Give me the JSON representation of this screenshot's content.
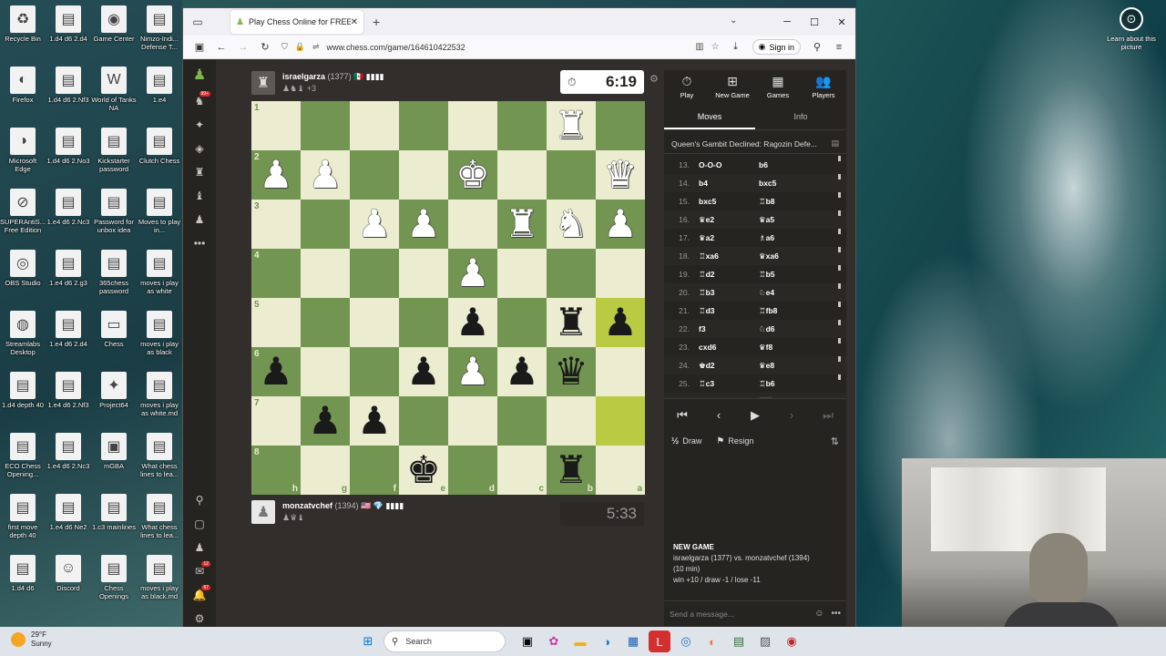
{
  "desktop": {
    "icons": [
      {
        "label": "Recycle Bin",
        "glyph": "♻"
      },
      {
        "label": "1.d4 d6 2.d4",
        "glyph": "▤"
      },
      {
        "label": "Game Center",
        "glyph": "◉"
      },
      {
        "label": "Nimzo-Indi... Defense T...",
        "glyph": "▤"
      },
      {
        "label": "Firefox",
        "glyph": "◐"
      },
      {
        "label": "1.d4 d6 2.Nf3",
        "glyph": "▤"
      },
      {
        "label": "World of Tanks NA",
        "glyph": "W"
      },
      {
        "label": "1.e4",
        "glyph": "▤"
      },
      {
        "label": "Microsoft Edge",
        "glyph": "◑"
      },
      {
        "label": "1.d4 d6 2.No3",
        "glyph": "▤"
      },
      {
        "label": "Kickstarter password",
        "glyph": "▤"
      },
      {
        "label": "Clutch Chess",
        "glyph": "▤"
      },
      {
        "label": "SUPERAntiS... Free Edition",
        "glyph": "⊘"
      },
      {
        "label": "1.e4 d6 2.Nc3",
        "glyph": "▤"
      },
      {
        "label": "Password for unbox idea",
        "glyph": "▤"
      },
      {
        "label": "Moves to play in...",
        "glyph": "▤"
      },
      {
        "label": "OBS Studio",
        "glyph": "◎"
      },
      {
        "label": "1.e4 d6 2.g3",
        "glyph": "▤"
      },
      {
        "label": "365chess password",
        "glyph": "▤"
      },
      {
        "label": "moves i play as white",
        "glyph": "▤"
      },
      {
        "label": "Streamlabs Desktop",
        "glyph": "◍"
      },
      {
        "label": "1.e4 d6 2.d4",
        "glyph": "▤"
      },
      {
        "label": "Chess",
        "glyph": "▭"
      },
      {
        "label": "moves i play as black",
        "glyph": "▤"
      },
      {
        "label": "1.d4 depth 40",
        "glyph": "▤"
      },
      {
        "label": "1.e4 d6 2.Nf3",
        "glyph": "▤"
      },
      {
        "label": "Project64",
        "glyph": "✦"
      },
      {
        "label": "moves i play as white.md",
        "glyph": "▤"
      },
      {
        "label": "ECO Chess Opening...",
        "glyph": "▤"
      },
      {
        "label": "1.e4 d6 2.Nc3",
        "glyph": "▤"
      },
      {
        "label": "mGBA",
        "glyph": "▣"
      },
      {
        "label": "What chess lines to lea...",
        "glyph": "▤"
      },
      {
        "label": "first move depth 40",
        "glyph": "▤"
      },
      {
        "label": "1.e4 d6 Ne2",
        "glyph": "▤"
      },
      {
        "label": "1.c3 mainlines",
        "glyph": "▤"
      },
      {
        "label": "What chess lines to lea...",
        "glyph": "▤"
      },
      {
        "label": "1.d4 d6",
        "glyph": "▤"
      },
      {
        "label": "Discord",
        "glyph": "☺"
      },
      {
        "label": "Chess Openings",
        "glyph": "▤"
      },
      {
        "label": "moves i play as black.md",
        "glyph": "▤"
      }
    ],
    "learn_about": "Learn about this picture"
  },
  "browser": {
    "tab_title": "Play Chess Online for FREE - 2 P",
    "url": "www.chess.com/game/164610422532",
    "sign_in": "Sign in"
  },
  "game": {
    "top_player": {
      "name": "israelgarza",
      "rating": "(1377)",
      "flag": "🇲🇽 ▮▮▮▮",
      "captured": "♟♞♝ +3"
    },
    "bottom_player": {
      "name": "monzatvchef",
      "rating": "(1394)",
      "flag": "🇺🇸 💎 ▮▮▮▮",
      "captured": "♟♛♝"
    },
    "top_clock": "6:19",
    "bottom_clock": "5:33",
    "ranks": [
      "1",
      "2",
      "3",
      "4",
      "5",
      "6",
      "7",
      "8"
    ],
    "files": [
      "h",
      "g",
      "f",
      "e",
      "d",
      "c",
      "b",
      "a"
    ],
    "board": [
      [
        "",
        "",
        "",
        "",
        "",
        "",
        "wR",
        ""
      ],
      [
        "wP",
        "wP",
        "",
        "",
        "wK",
        "",
        "",
        "wQ"
      ],
      [
        "",
        "",
        "wP",
        "wP",
        "",
        "wR",
        "wN",
        "wP"
      ],
      [
        "",
        "",
        "",
        "",
        "wP",
        "",
        "",
        ""
      ],
      [
        "",
        "",
        "",
        "",
        "bP",
        "",
        "bR",
        "bP"
      ],
      [
        "bP",
        "",
        "",
        "bP",
        "wP",
        "bP",
        "bQ",
        ""
      ],
      [
        "",
        "bP",
        "bP",
        "",
        "",
        "",
        "",
        ""
      ],
      [
        "",
        "",
        "",
        "bK",
        "",
        "",
        "bR",
        ""
      ]
    ],
    "highlights": [
      [
        4,
        7
      ],
      [
        6,
        7
      ]
    ]
  },
  "panel": {
    "tabs": [
      {
        "label": "Play",
        "glyph": "⏱"
      },
      {
        "label": "New Game",
        "glyph": "⊞"
      },
      {
        "label": "Games",
        "glyph": "▦"
      },
      {
        "label": "Players",
        "glyph": "👥"
      }
    ],
    "subtabs": [
      "Moves",
      "Info"
    ],
    "opening": "Queen's Gambit Declined: Ragozin Defe...",
    "moves": [
      {
        "n": "13.",
        "w": "O-O-O",
        "b": "b6"
      },
      {
        "n": "14.",
        "w": "b4",
        "b": "bxc5"
      },
      {
        "n": "15.",
        "w": "bxc5",
        "b": "♖b8"
      },
      {
        "n": "16.",
        "w": "♛e2",
        "b": "♛a5"
      },
      {
        "n": "17.",
        "w": "♛a2",
        "b": "♗a6"
      },
      {
        "n": "18.",
        "w": "♖xa6",
        "b": "♛xa6"
      },
      {
        "n": "19.",
        "w": "♖d2",
        "b": "♖b5"
      },
      {
        "n": "20.",
        "w": "♖b3",
        "b": "♘e4"
      },
      {
        "n": "21.",
        "w": "♖d3",
        "b": "♖fb8"
      },
      {
        "n": "22.",
        "w": "f3",
        "b": "♘d6"
      },
      {
        "n": "23.",
        "w": "cxd6",
        "b": "♛f8"
      },
      {
        "n": "24.",
        "w": "♚d2",
        "b": "♛e8"
      },
      {
        "n": "25.",
        "w": "♖c3",
        "b": "♖b6"
      },
      {
        "n": "26.",
        "w": "♖b1",
        "b": "a5"
      }
    ],
    "controls": [
      "⏮",
      "‹",
      "▶",
      "›",
      "⏭"
    ],
    "draw": "Draw",
    "resign": "Resign",
    "new_game_heading": "NEW GAME",
    "new_game_players": "israelgarza (1377) vs. monzatvchef (1394)",
    "new_game_time": "(10 min)",
    "new_game_stakes": "win +10 / draw -1 / lose -11",
    "chat_placeholder": "Send a message..."
  },
  "taskbar": {
    "temp": "29°F",
    "condition": "Sunny",
    "search": "Search"
  }
}
